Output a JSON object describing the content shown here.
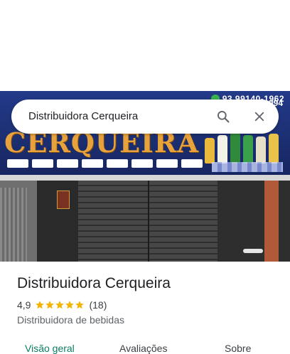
{
  "search": {
    "query": "Distribuidora Cerqueira"
  },
  "photo": {
    "phone_line1": "93 99140-1962",
    "phone_line2": "994",
    "sign_text": "CERQUEIRA"
  },
  "place": {
    "name": "Distribuidora Cerqueira",
    "rating": "4,9",
    "rating_value": 4.9,
    "review_count": "(18)",
    "category": "Distribuidora de bebidas"
  },
  "tabs": [
    {
      "label": "Visão geral",
      "active": true
    },
    {
      "label": "Avaliações",
      "active": false
    },
    {
      "label": "Sobre",
      "active": false
    }
  ],
  "colors": {
    "accent": "#0b7d63",
    "star": "#f4b400"
  },
  "icons": {
    "search": "search-icon",
    "close": "close-icon",
    "star": "star-icon"
  }
}
